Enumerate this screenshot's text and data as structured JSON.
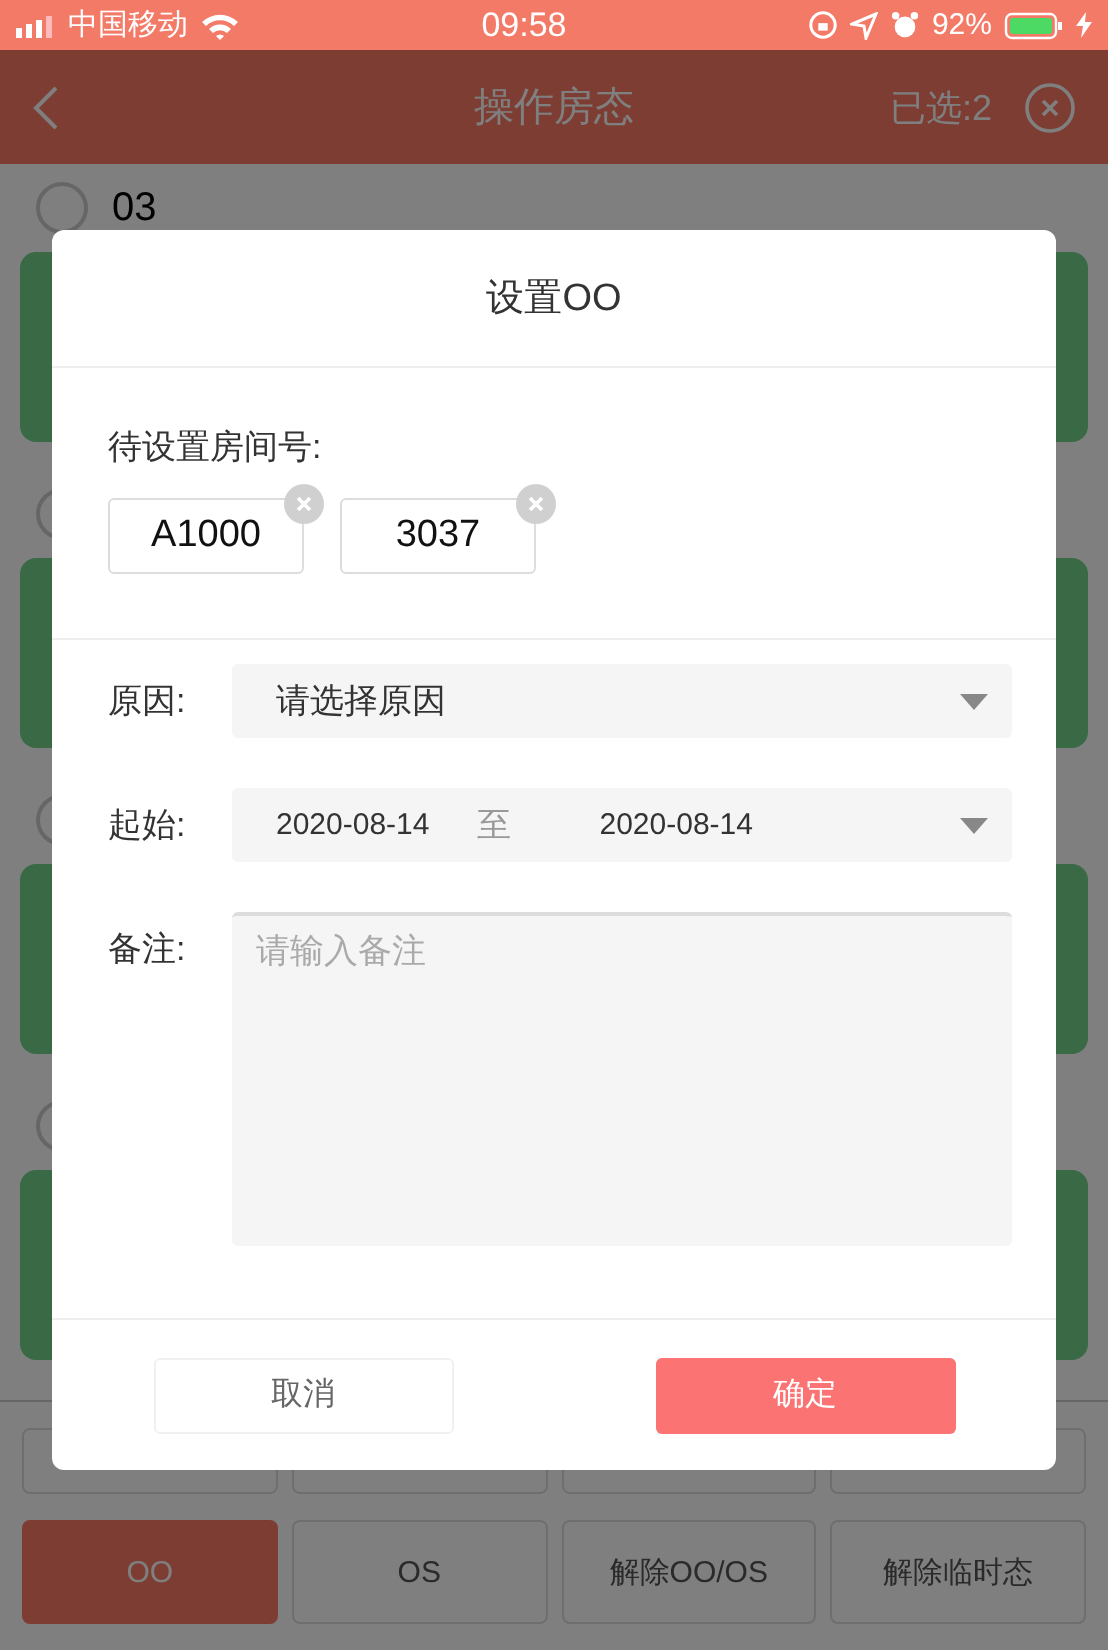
{
  "status_bar": {
    "carrier": "中国移动",
    "time": "09:58",
    "battery": "92%"
  },
  "header": {
    "title": "操作房态",
    "selected_count": "已选:2"
  },
  "groups": [
    {
      "title": "03",
      "checked": false
    }
  ],
  "bottom_buttons": [
    {
      "selected": false
    },
    {
      "selected": false
    },
    {
      "selected": false
    },
    {
      "selected": false
    },
    {
      "label": "OO",
      "selected": true
    },
    {
      "label": "OS",
      "selected": false
    },
    {
      "label": "解除OO/OS",
      "selected": false
    },
    {
      "label": "解除临时态",
      "selected": false
    }
  ],
  "dialog": {
    "title": "设置OO",
    "rooms_label": "待设置房间号:",
    "rooms": [
      "A1000",
      "3037"
    ],
    "reason": {
      "label": "原因:",
      "value": "请选择原因"
    },
    "period": {
      "label": "起始:",
      "start": "2020-08-14",
      "separator": "至",
      "end": "2020-08-14"
    },
    "note": {
      "label": "备注:",
      "placeholder": "请输入备注"
    },
    "buttons": [
      {
        "label": "取消",
        "kind": "cancel"
      },
      {
        "label": "确定",
        "kind": "confirm"
      }
    ]
  }
}
